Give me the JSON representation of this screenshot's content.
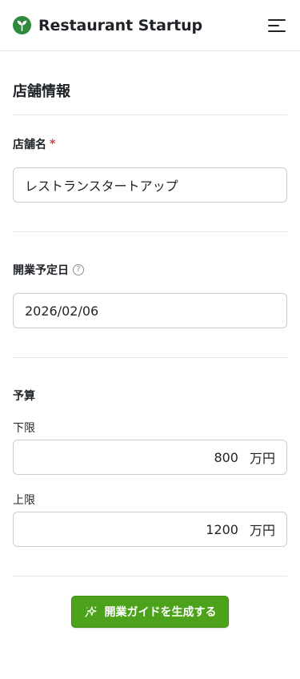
{
  "header": {
    "brand_name": "Restaurant Startup",
    "logo_icon": "sprout-icon",
    "menu_icon": "hamburger-menu-icon"
  },
  "form": {
    "section_title": "店舗情報",
    "store_name": {
      "label": "店舗名",
      "required_mark": "*",
      "value": "レストランスタートアップ"
    },
    "opening_date": {
      "label": "開業予定日",
      "help_icon": "question-circle-icon",
      "help_glyph": "?",
      "value": "2026/02/06"
    },
    "budget": {
      "label": "予算",
      "lower": {
        "label": "下限",
        "value": "800",
        "unit": "万円"
      },
      "upper": {
        "label": "上限",
        "value": "1200",
        "unit": "万円"
      }
    },
    "submit_label": "開業ガイドを生成する",
    "submit_icon": "sparkle-icon"
  },
  "colors": {
    "accent": "#4ca21b",
    "required": "#d33b3b",
    "border": "#c9ccd1",
    "divider": "#e6e7ea"
  }
}
